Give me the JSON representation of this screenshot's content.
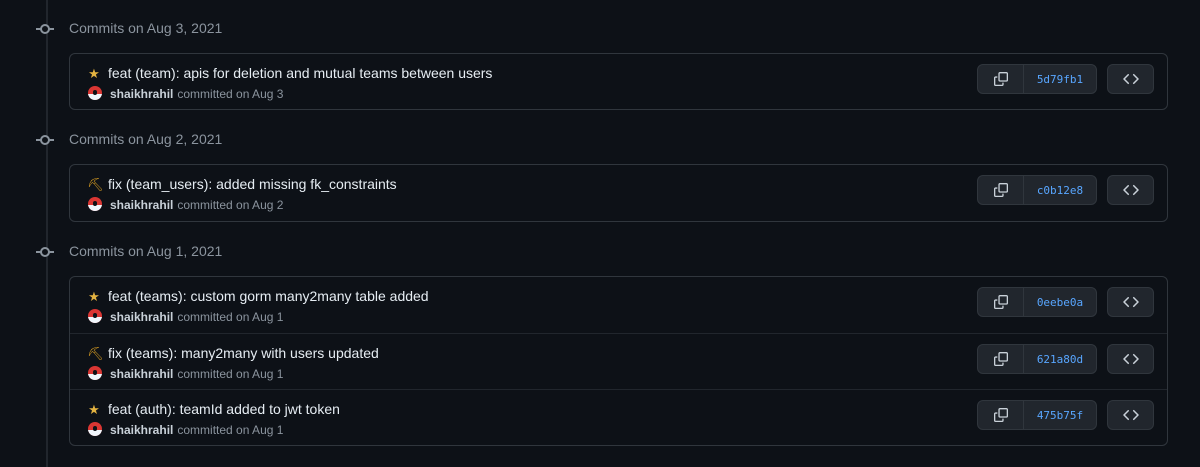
{
  "groups": [
    {
      "title": "Commits on Aug 3, 2021",
      "commits": [
        {
          "icon": "star-icon",
          "message": "feat (team): apis for deletion and mutual teams between users",
          "author": "shaikhrahil",
          "date_text": "committed on Aug 3",
          "sha": "5d79fb1"
        }
      ]
    },
    {
      "title": "Commits on Aug 2, 2021",
      "commits": [
        {
          "icon": "pick-icon",
          "message": "fix (team_users): added missing fk_constraints",
          "author": "shaikhrahil",
          "date_text": "committed on Aug 2",
          "sha": "c0b12e8"
        }
      ]
    },
    {
      "title": "Commits on Aug 1, 2021",
      "commits": [
        {
          "icon": "star-icon",
          "message": "feat (teams): custom gorm many2many table added",
          "author": "shaikhrahil",
          "date_text": "committed on Aug 1",
          "sha": "0eebe0a"
        },
        {
          "icon": "pick-icon",
          "message": "fix (teams): many2many with users updated",
          "author": "shaikhrahil",
          "date_text": "committed on Aug 1",
          "sha": "621a80d"
        },
        {
          "icon": "star-icon",
          "message": "feat (auth): teamId added to jwt token",
          "author": "shaikhrahil",
          "date_text": "committed on Aug 1",
          "sha": "475b75f"
        }
      ]
    }
  ],
  "icons": {
    "star": "★",
    "pick": "⛏"
  },
  "colors": {
    "background": "#0d1117",
    "border": "#30363d",
    "sha": "#58a6ff",
    "muted": "#8b949e",
    "star": "#e3b341"
  }
}
